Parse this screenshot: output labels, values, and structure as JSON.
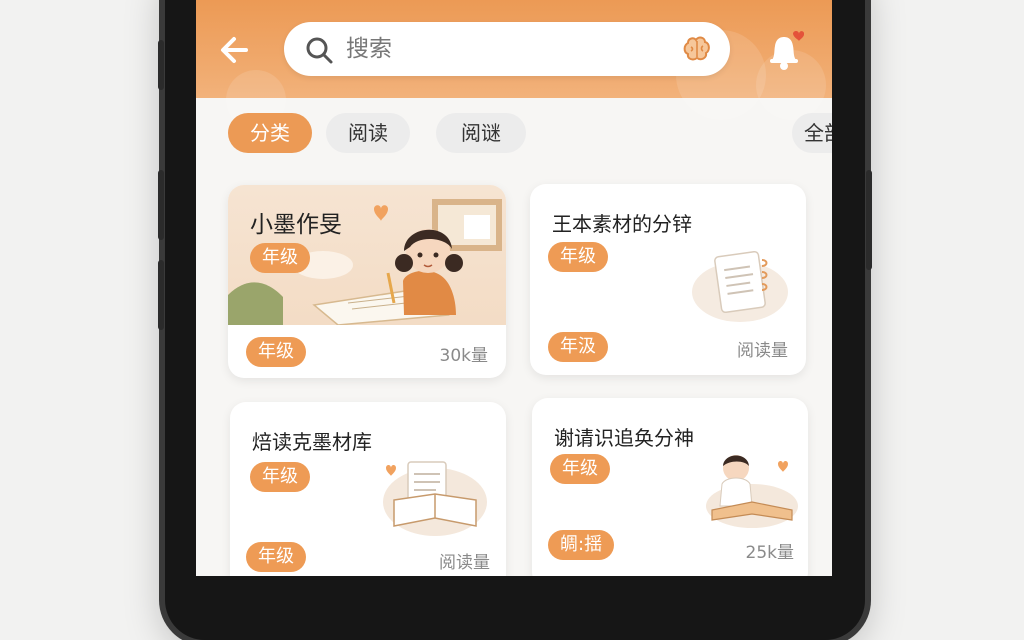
{
  "header": {
    "back_icon": "arrow-left-icon",
    "search": {
      "placeholder": "搜索",
      "icon": "search-icon",
      "voice_icon": "brain-icon"
    },
    "bell_icon": "bell-icon",
    "accent": "#ec9a55"
  },
  "tabs": [
    {
      "label": "分类",
      "active": true
    },
    {
      "label": "阅读",
      "active": false
    },
    {
      "label": "阅谜",
      "active": false
    },
    {
      "label": "全部",
      "active": false
    }
  ],
  "cards": [
    {
      "title": "小墨作旻",
      "tag": "年级",
      "bottom_tag": "年级",
      "meta": "30k量"
    },
    {
      "title": "王本素材的分锌",
      "tag": "年级",
      "bottom_tag": "年汲",
      "meta": "阅读量"
    },
    {
      "title": "焙读克墨材库",
      "tag": "年级",
      "bottom_tag": "年级",
      "meta": "阅读量"
    },
    {
      "title": "谢请识追奂分神",
      "tag": "年级",
      "bottom_tag": "皗:揺",
      "meta": "25k量"
    }
  ]
}
